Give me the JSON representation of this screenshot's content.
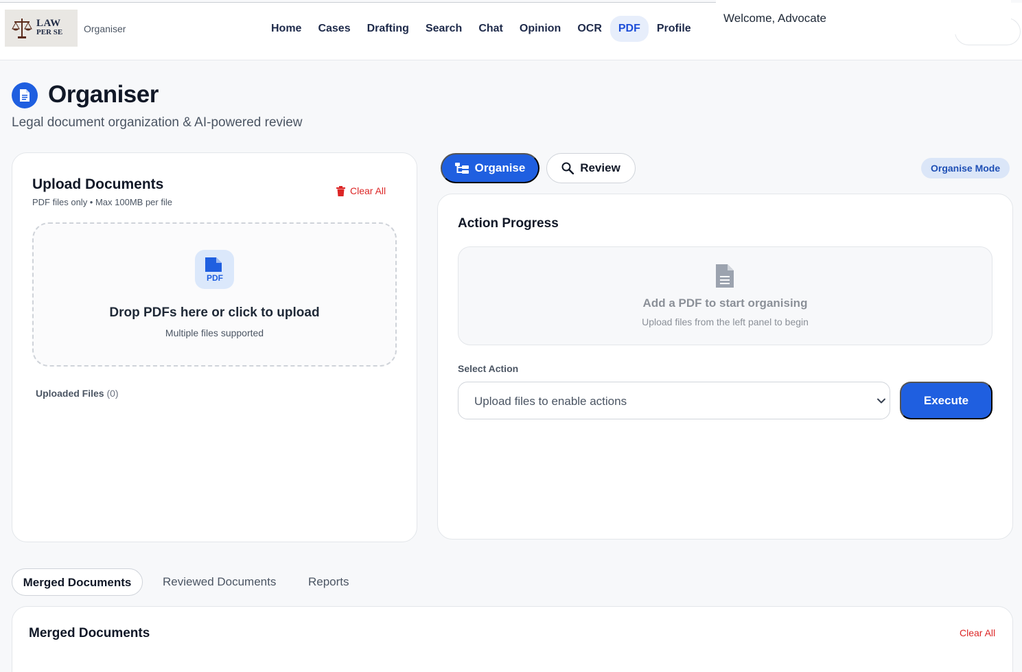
{
  "header": {
    "logo_line1": "LAW",
    "logo_line2": "PER SE",
    "brand_subtitle": "Organiser",
    "nav": [
      "Home",
      "Cases",
      "Drafting",
      "Search",
      "Chat",
      "Opinion",
      "OCR",
      "PDF",
      "Profile"
    ],
    "active_nav": "PDF",
    "welcome": "Welcome, Advocate"
  },
  "page": {
    "title": "Organiser",
    "subtitle": "Legal document organization & AI-powered review"
  },
  "upload": {
    "title": "Upload Documents",
    "subtitle": "PDF files only • Max 100MB per file",
    "clear_all": "Clear All",
    "pdf_tile_label": "PDF",
    "drop_title": "Drop PDFs here or click to upload",
    "drop_sub": "Multiple files supported",
    "uploaded_label": "Uploaded Files",
    "uploaded_count": "(0)"
  },
  "modes": {
    "organise_label": "Organise",
    "review_label": "Review",
    "badge": "Organise Mode"
  },
  "action": {
    "title": "Action Progress",
    "empty_title": "Add a PDF to start organising",
    "empty_sub": "Upload files from the left panel to begin",
    "select_label": "Select Action",
    "select_value": "Upload files to enable actions",
    "execute_label": "Execute"
  },
  "tabs": {
    "merged": "Merged Documents",
    "reviewed": "Reviewed Documents",
    "reports": "Reports"
  },
  "merged": {
    "title": "Merged Documents",
    "clear_all": "Clear All"
  },
  "icons": {
    "title": "document-icon",
    "trash": "trash-icon",
    "pdf": "pdf-file-icon",
    "organise": "sitemap-icon",
    "review": "search-icon",
    "empty": "file-lines-icon",
    "chevron": "chevron-down-icon"
  },
  "colors": {
    "primary": "#1f5fe0",
    "danger": "#dc2626",
    "active_nav_bg": "#e7eefb",
    "badge_bg": "#dbe6f8"
  }
}
